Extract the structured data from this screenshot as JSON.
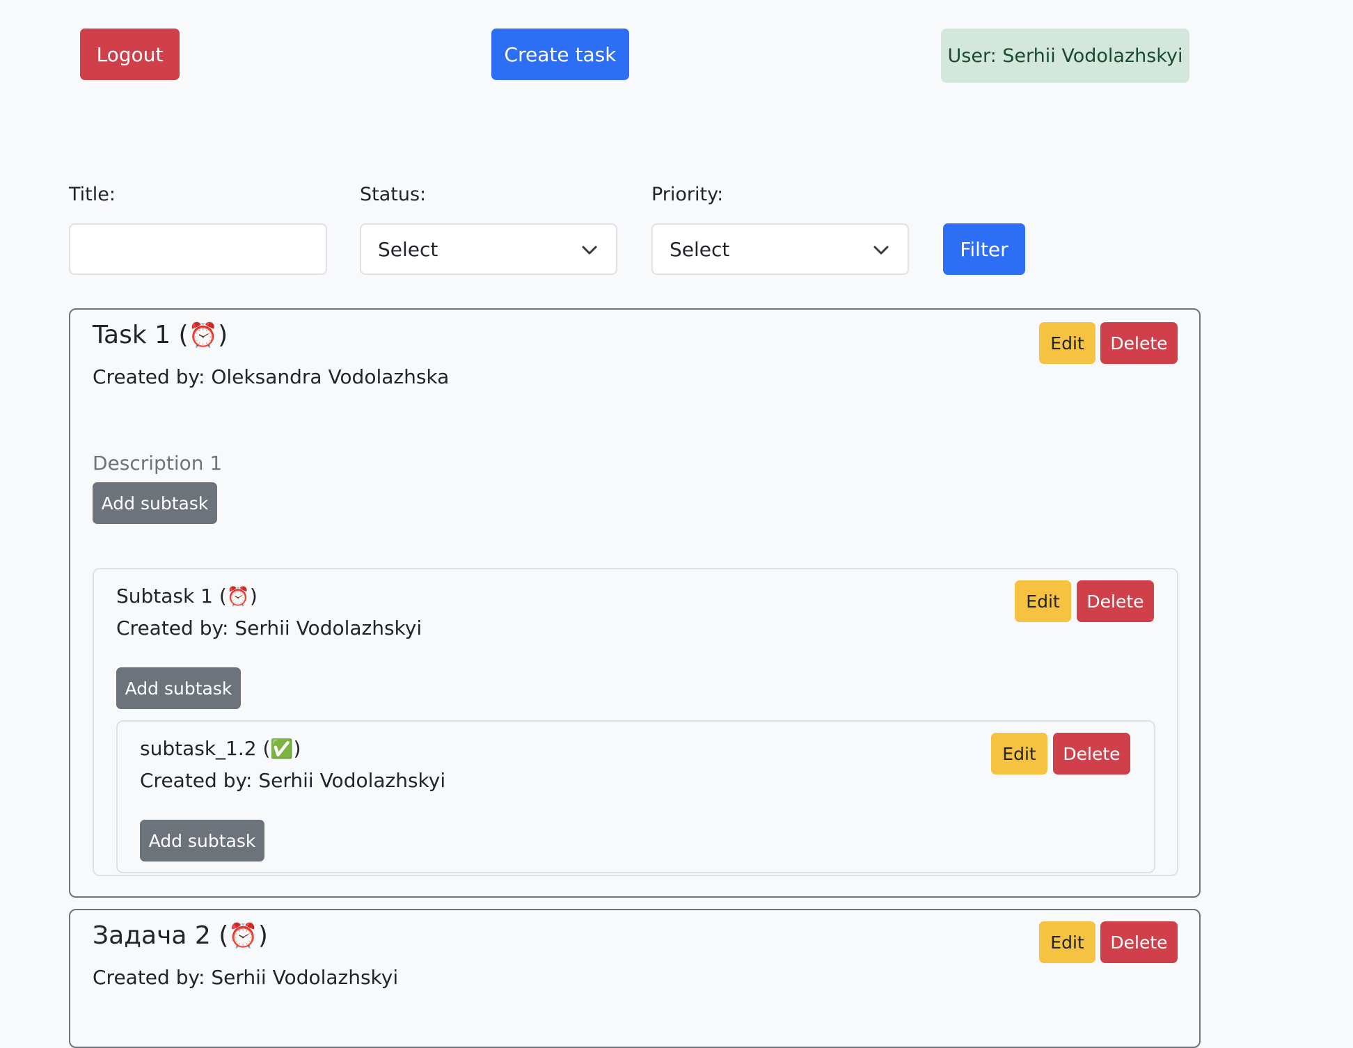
{
  "header": {
    "logout_label": "Logout",
    "create_task_label": "Create task",
    "user_label": "User: Serhii Vodolazhskyi"
  },
  "filters": {
    "title_label": "Title:",
    "title_value": "",
    "status_label": "Status:",
    "status_value": "Select",
    "priority_label": "Priority:",
    "priority_value": "Select",
    "filter_label": "Filter"
  },
  "tasks": [
    {
      "title": "Task 1",
      "status_icon": "⏰",
      "created_by": "Created by: Oleksandra Vodolazhska",
      "description": "Description 1",
      "edit_label": "Edit",
      "delete_label": "Delete",
      "add_subtask_label": "Add subtask",
      "subtasks": [
        {
          "title": "Subtask 1",
          "status_icon": "⏰",
          "created_by": "Created by: Serhii Vodolazhskyi",
          "edit_label": "Edit",
          "delete_label": "Delete",
          "add_subtask_label": "Add subtask",
          "subtasks": [
            {
              "title": "subtask_1.2",
              "status_icon": "✅",
              "created_by": "Created by: Serhii Vodolazhskyi",
              "edit_label": "Edit",
              "delete_label": "Delete",
              "add_subtask_label": "Add subtask"
            }
          ]
        }
      ]
    },
    {
      "title": "Задача 2",
      "status_icon": "⏰",
      "created_by": "Created by: Serhii Vodolazhskyi",
      "edit_label": "Edit",
      "delete_label": "Delete"
    }
  ],
  "icons": {
    "pending": "alarm-clock-icon",
    "done": "check-mark-icon",
    "select_arrow": "chevron-down-icon"
  },
  "colors": {
    "danger": "#cf404b",
    "primary": "#2c6ff4",
    "warning": "#f5c242",
    "secondary": "#6c737b",
    "success_badge_bg": "#d4e7dc"
  }
}
